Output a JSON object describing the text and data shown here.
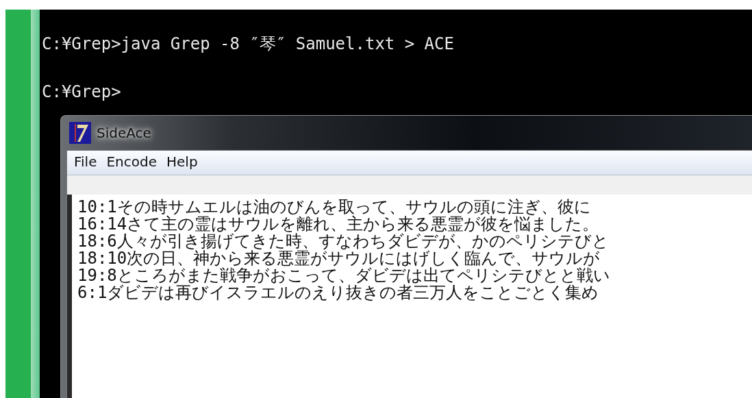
{
  "console": {
    "lines": [
      "C:¥Grep>java Grep -8 ″琴″ Samuel.txt > ACE",
      "C:¥Grep>"
    ]
  },
  "window": {
    "title": "SideAce"
  },
  "menu": [
    "File",
    "Encode",
    "Help"
  ],
  "results": [
    "10:1その時サムエルは油のびんを取って、サウルの頭に注ぎ、彼に",
    "16:14さて主の霊はサウルを離れ、主から来る悪霊が彼を悩ました。",
    "18:6人々が引き揚げてきた時、すなわちダビデが、かのペリシテびと",
    "18:10次の日、神から来る悪霊がサウルにはげしく臨んで、サウルが",
    "19:8ところがまた戦争がおこって、ダビデは出てペリシテびとと戦い",
    "6:1ダビデは再びイスラエルのえり抜きの者三万人をことごとく集め"
  ]
}
